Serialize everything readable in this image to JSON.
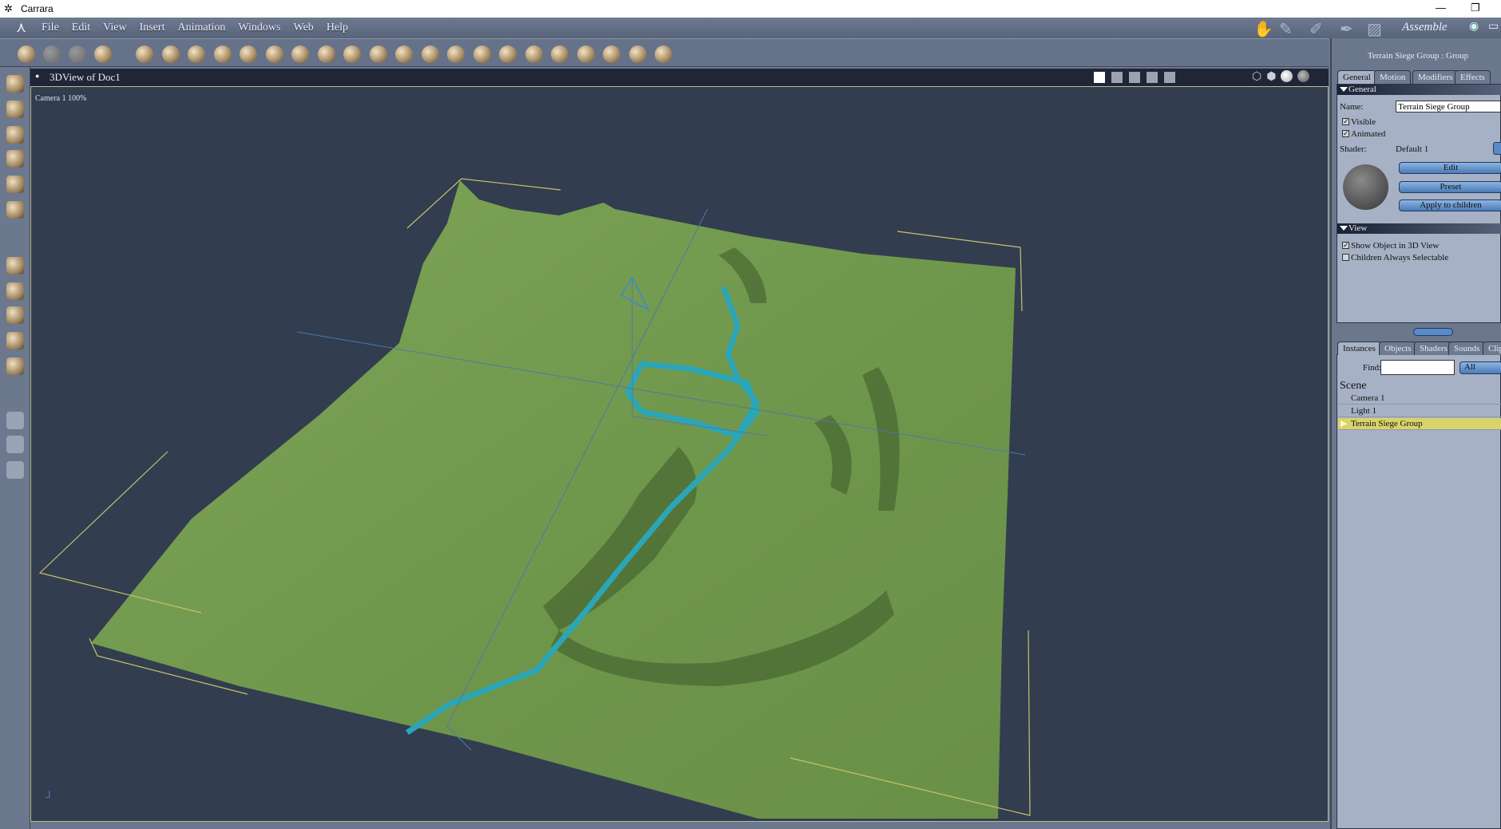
{
  "app": {
    "title": "Carrara",
    "window_controls": [
      "minimize",
      "restore"
    ]
  },
  "menu": [
    "File",
    "Edit",
    "View",
    "Insert",
    "Animation",
    "Windows",
    "Web",
    "Help"
  ],
  "rooms": {
    "icons": [
      "assemble-room-icon",
      "model-room-icon",
      "storyboard-room-icon",
      "texture-room-icon",
      "render-room-icon"
    ],
    "active_label": "Assemble"
  },
  "toolbar": {
    "icons": [
      "interactive-tool-icon",
      "hand-tool-icon",
      "wrench-tool-icon",
      "shader-brush-icon",
      "sphere-icon",
      "goblet-icon",
      "globe-icon",
      "bones-icon",
      "ring-icon",
      "text-icon",
      "particles-icon",
      "terrain-icon",
      "tree-icon",
      "cloud-icon",
      "fire-icon",
      "plant-icon",
      "ocean-icon",
      "house-icon",
      "bowl-icon",
      "rock-icon",
      "light-icon",
      "camera-icon",
      "network-icon",
      "target-icon",
      "bone-icon"
    ]
  },
  "left_tools": [
    "select-arrow-icon",
    "direct-manip-icon",
    "rotate-icon",
    "spin-icon",
    "pencil-icon",
    "dropper-icon",
    "move-xy-icon",
    "move-xz-icon",
    "move-yz-icon",
    "move-3d-icon",
    "box-view-icon",
    "camera-icon",
    "pan-hand-icon",
    "zoom-icon"
  ],
  "viewport": {
    "title": "3DView of Doc1",
    "camera_label": "Camera 1 100%"
  },
  "properties": {
    "heading": "Terrain Siege Group : Group",
    "tabs": [
      "General",
      "Motion",
      "Modifiers",
      "Effects"
    ],
    "general_section": "General",
    "name_label": "Name:",
    "name_value": "Terrain Siege Group",
    "visible_label": "Visible",
    "visible": true,
    "animated_label": "Animated",
    "animated": true,
    "shader_label": "Shader:",
    "shader_value": "Default 1",
    "edit": "Edit",
    "preset": "Preset",
    "apply": "Apply to children",
    "view_section": "View",
    "show_3d_label": "Show Object in 3D View",
    "show_3d": true,
    "children_label": "Children Always Selectable",
    "children": false
  },
  "browser": {
    "tabs": [
      "Instances",
      "Objects",
      "Shaders",
      "Sounds",
      "Clips"
    ],
    "find_label": "Find:",
    "find_value": "",
    "filter": "All",
    "scene_label": "Scene",
    "items": [
      "Camera 1",
      "Light 1",
      "Terrain Siege Group"
    ],
    "selected": "Terrain Siege Group",
    "selected_color": "#d8d36a"
  },
  "colors": {
    "terrain": "#6f9a4c",
    "river": "#2aa6b8",
    "viewport_bg": "#323d50"
  }
}
